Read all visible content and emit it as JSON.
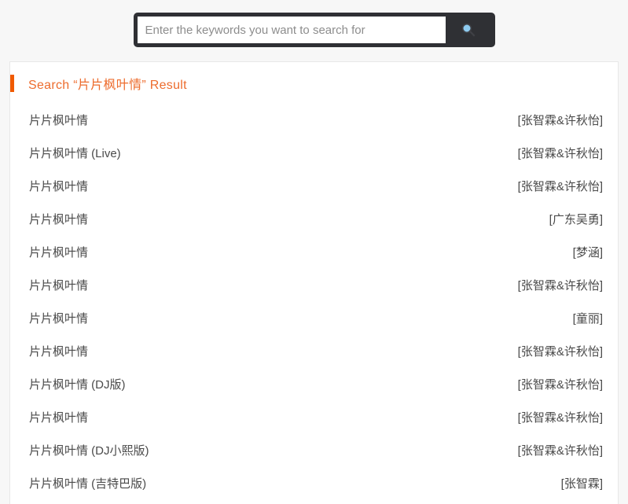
{
  "search": {
    "placeholder": "Enter the keywords you want to search for",
    "value": "",
    "button_icon": "search-icon",
    "wrapper_color": "#2f3034",
    "icon_color": "#8ecbf0"
  },
  "results_panel": {
    "title_prefix": "Search",
    "query": "片片枫叶情",
    "title": "Search “片片枫叶情” Result",
    "accent_color": "#f05a00",
    "title_color": "#ed6c2d",
    "rows": [
      {
        "title": "片片枫叶情",
        "artist": "[张智霖&许秋怡]"
      },
      {
        "title": "片片枫叶情 (Live)",
        "artist": "[张智霖&许秋怡]"
      },
      {
        "title": "片片枫叶情",
        "artist": "[张智霖&许秋怡]"
      },
      {
        "title": "片片枫叶情",
        "artist": "[广东吴勇]"
      },
      {
        "title": "片片枫叶情",
        "artist": "[梦涵]"
      },
      {
        "title": "片片枫叶情",
        "artist": "[张智霖&许秋怡]"
      },
      {
        "title": "片片枫叶情",
        "artist": "[童丽]"
      },
      {
        "title": "片片枫叶情",
        "artist": "[张智霖&许秋怡]"
      },
      {
        "title": "片片枫叶情 (DJ版)",
        "artist": "[张智霖&许秋怡]"
      },
      {
        "title": "片片枫叶情",
        "artist": "[张智霖&许秋怡]"
      },
      {
        "title": "片片枫叶情 (DJ小熙版)",
        "artist": "[张智霖&许秋怡]"
      },
      {
        "title": "片片枫叶情 (吉特巴版)",
        "artist": "[张智霖]"
      }
    ]
  }
}
